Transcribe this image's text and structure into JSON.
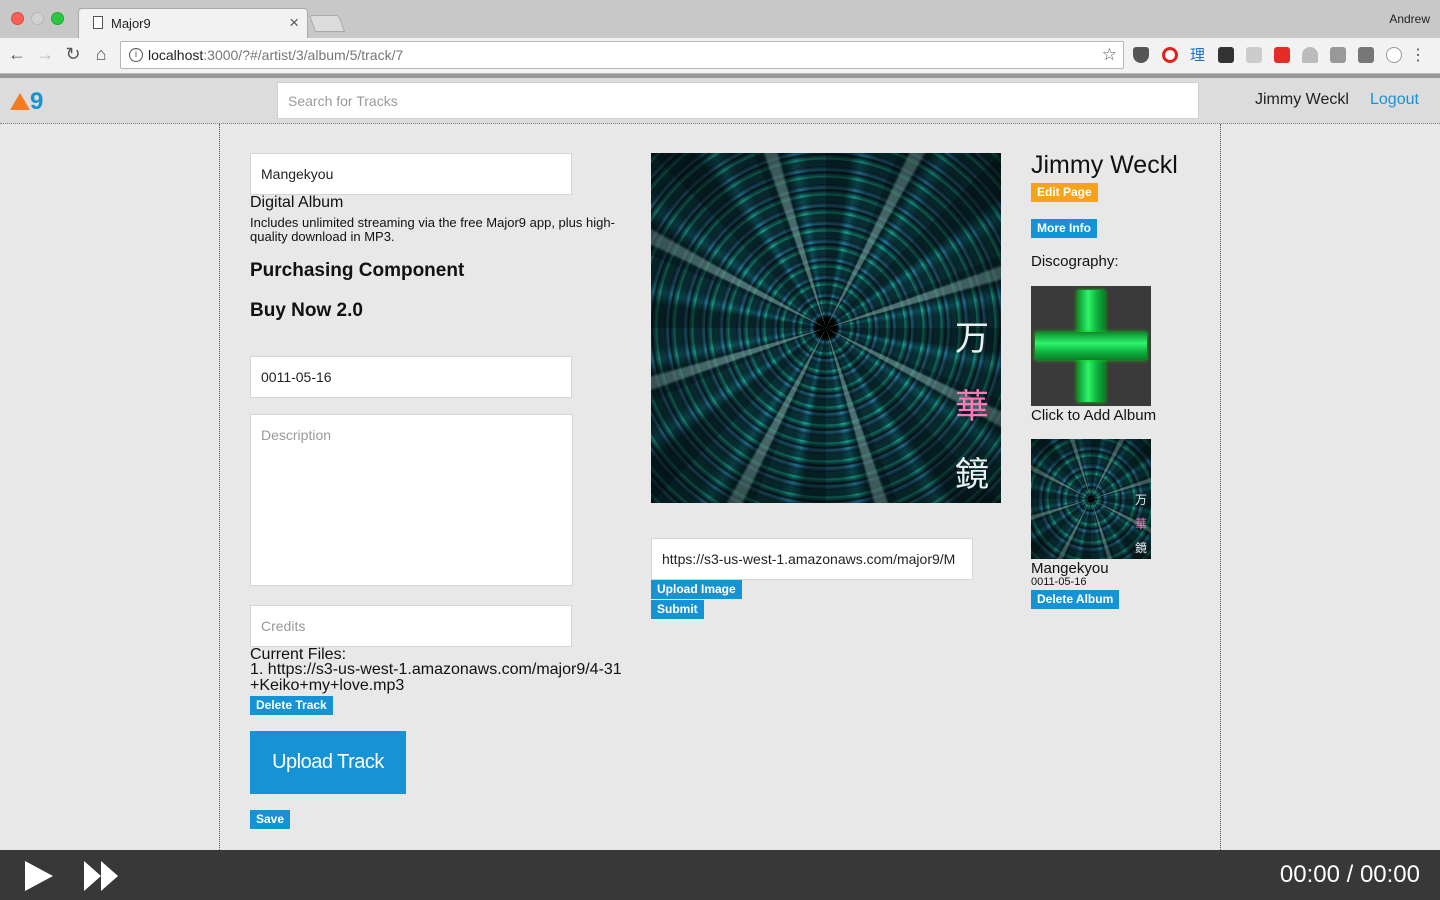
{
  "browser": {
    "tab_title": "Major9",
    "profile_name": "Andrew",
    "url_host": "localhost",
    "url_rest": ":3000/?#/artist/3/album/5/track/7"
  },
  "header": {
    "logo_text": "9",
    "search_placeholder": "Search for Tracks",
    "user_name": "Jimmy Weckl",
    "logout_label": "Logout"
  },
  "album_form": {
    "title_value": "Mangekyou",
    "format_label": "Digital Album",
    "format_desc": "Includes unlimited streaming via the free Major9 app, plus high-quality download in MP3.",
    "purchasing_heading": "Purchasing Component",
    "buy_now_heading": "Buy Now 2.0",
    "date_value": "0011-05-16",
    "description_placeholder": "Description",
    "credits_placeholder": "Credits",
    "current_files_label": "Current Files:",
    "file_1": "1. https://s3-us-west-1.amazonaws.com/major9/4-31+Keiko+my+love.mp3",
    "delete_track_label": "Delete Track",
    "upload_track_label": "Upload Track",
    "save_label": "Save"
  },
  "art_panel": {
    "kanji": [
      "万",
      "華",
      "鏡"
    ],
    "image_url_value": "https://s3-us-west-1.amazonaws.com/major9/M",
    "upload_image_label": "Upload Image",
    "submit_label": "Submit"
  },
  "artist_sidebar": {
    "artist_name": "Jimmy Weckl",
    "edit_page_label": "Edit Page",
    "more_info_label": "More Info",
    "discography_label": "Discography:",
    "add_album_label": "Click to Add Album",
    "albums": [
      {
        "title": "Mangekyou",
        "date": "0011-05-16",
        "delete_label": "Delete Album"
      }
    ]
  },
  "player": {
    "time_display": "00:00 / 00:00"
  },
  "colors": {
    "accent_blue": "#1593d4",
    "accent_orange": "#f7a21b",
    "player_bg": "#383838"
  }
}
